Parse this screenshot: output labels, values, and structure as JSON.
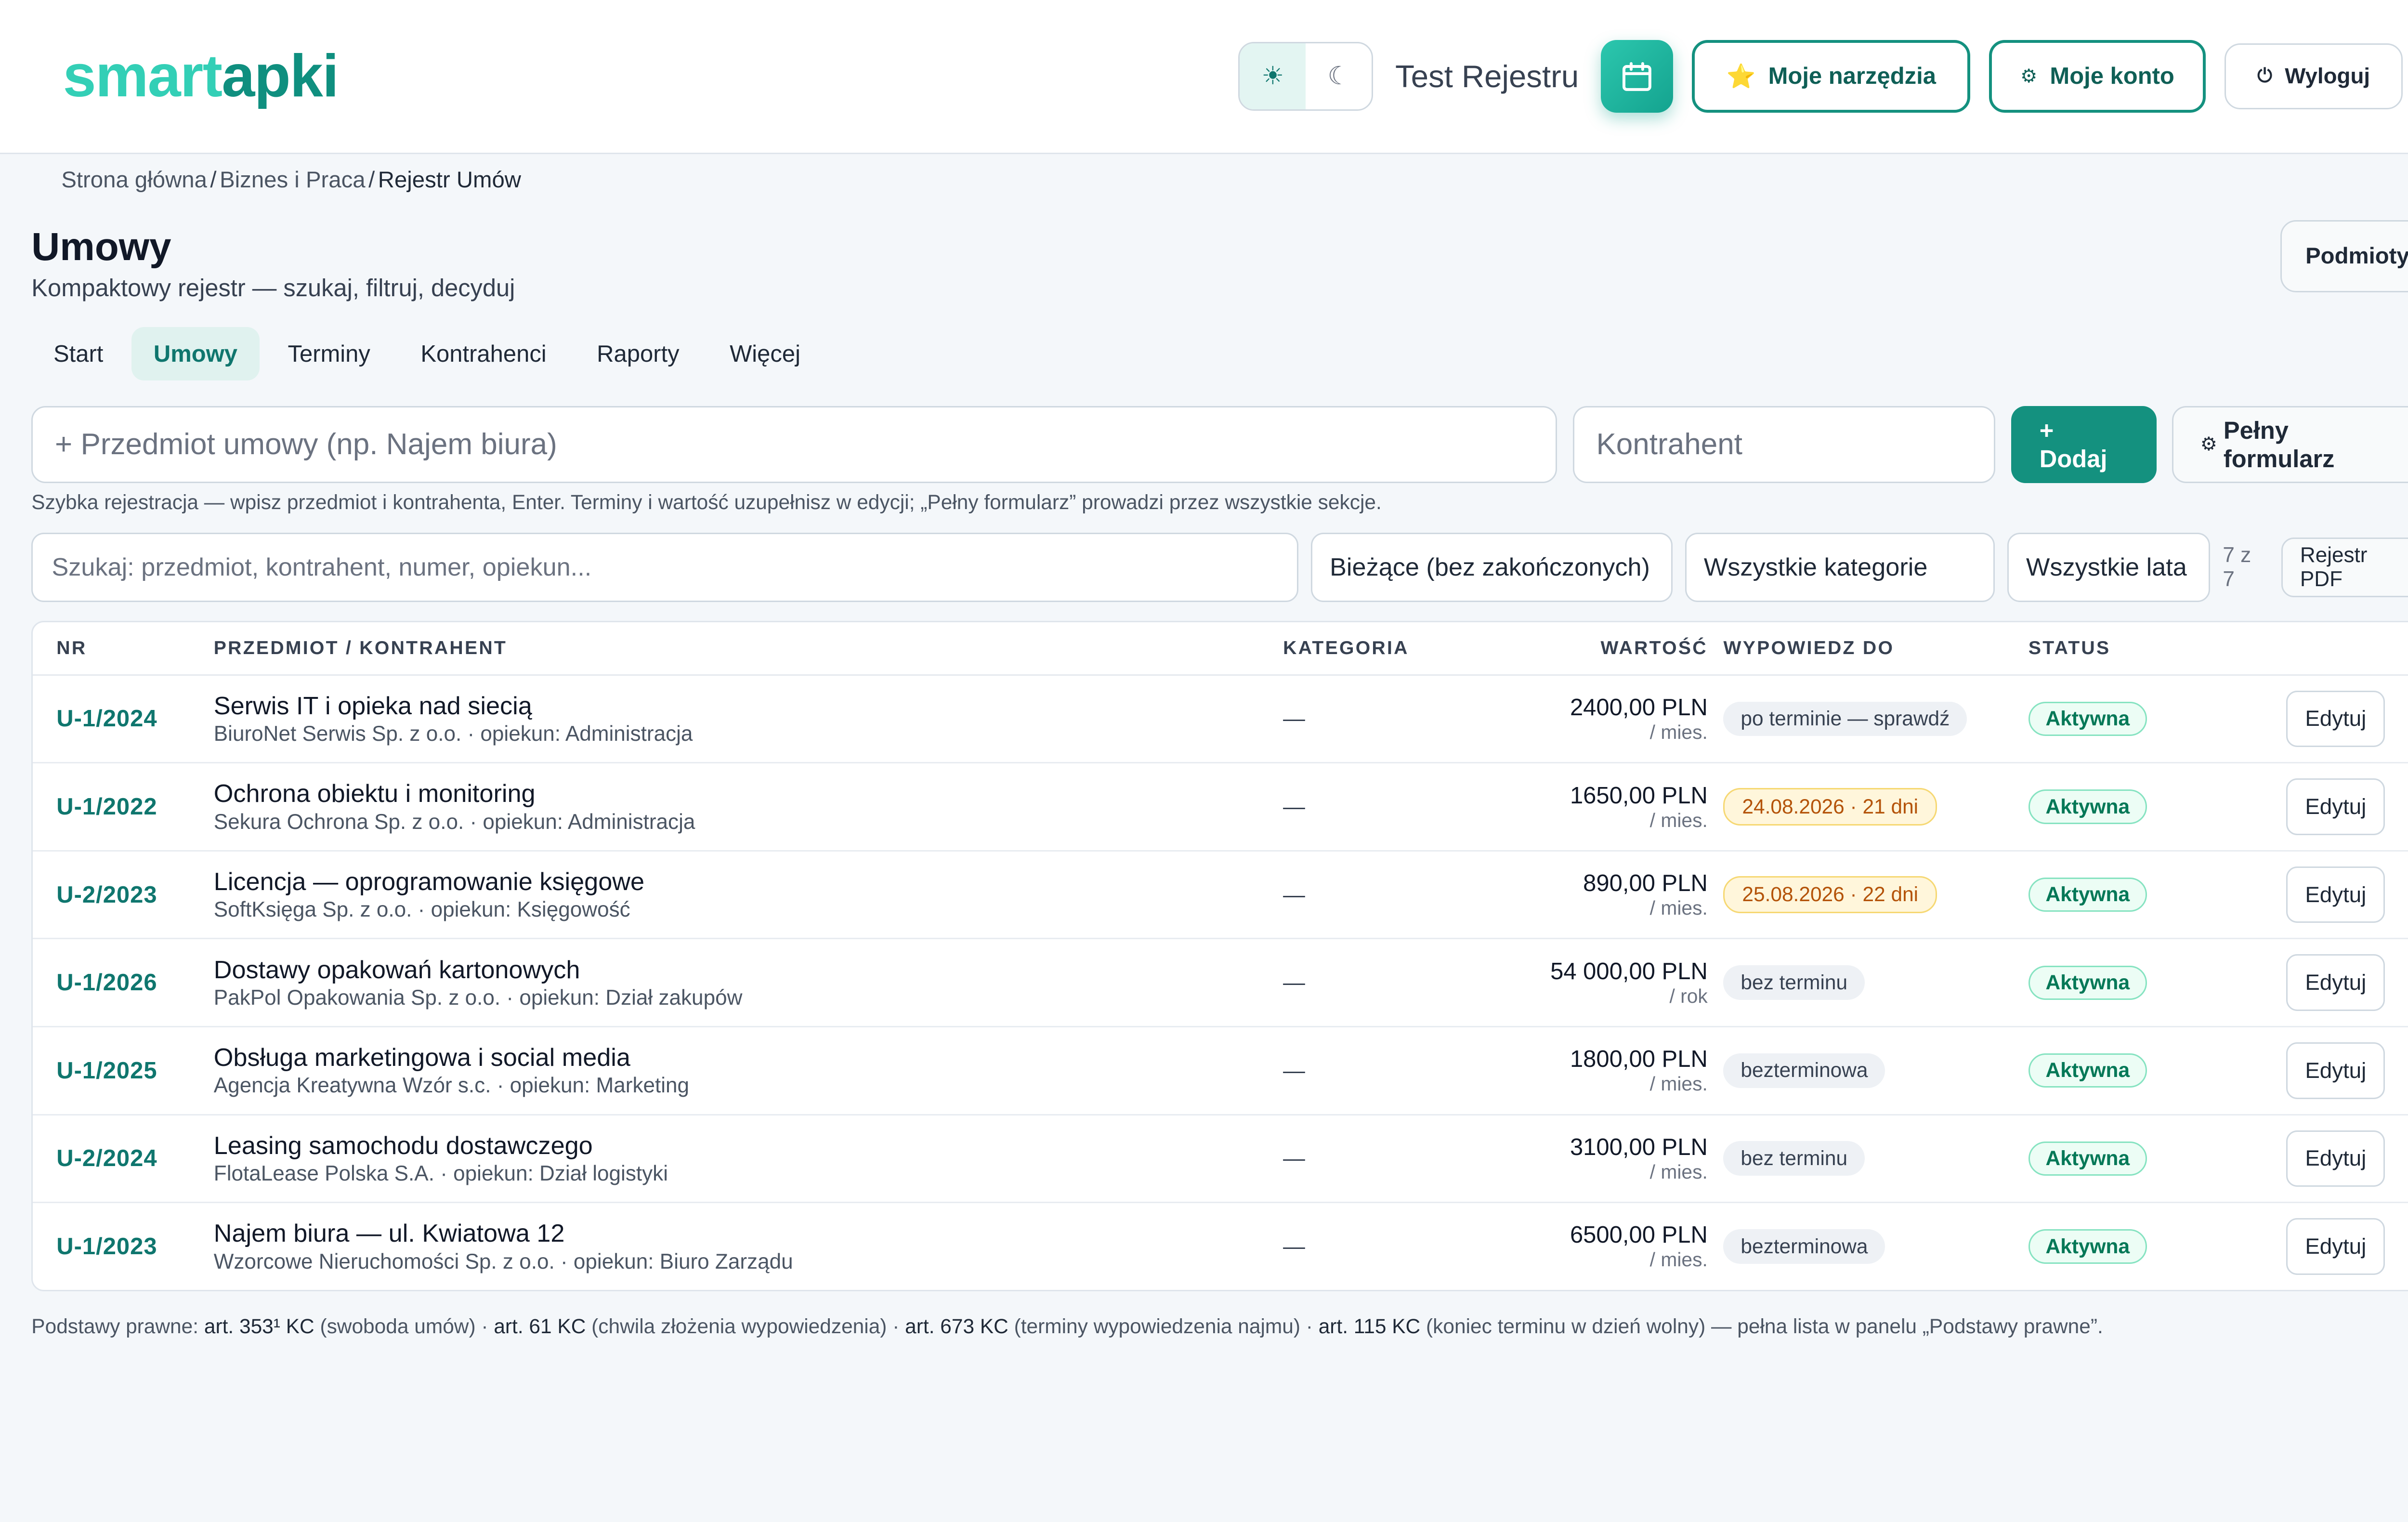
{
  "header": {
    "logo_part1": "smart",
    "logo_part2": "apki",
    "theme_light_icon": "☀",
    "theme_dark_icon": "☾",
    "user_name": "Test Rejestru",
    "tools_label": "Moje narzędzia",
    "tools_icon": "⭐",
    "account_label": "Moje konto",
    "account_icon": "⚙",
    "logout_label": "Wyloguj",
    "logout_icon": "⏻"
  },
  "breadcrumb": {
    "items": [
      "Strona główna",
      "Biznes i Praca",
      "Rejestr Umów"
    ],
    "separator": "/"
  },
  "page": {
    "title": "Umowy",
    "subtitle": "Kompaktowy rejestr — szukaj, filtruj, decyduj",
    "podmioty_label": "Podmioty"
  },
  "tabs": [
    {
      "label": "Start",
      "active": false
    },
    {
      "label": "Umowy",
      "active": true
    },
    {
      "label": "Terminy",
      "active": false
    },
    {
      "label": "Kontrahenci",
      "active": false
    },
    {
      "label": "Raporty",
      "active": false
    },
    {
      "label": "Więcej",
      "active": false
    }
  ],
  "quick_add": {
    "subject_placeholder": "+ Przedmiot umowy (np. Najem biura)",
    "party_placeholder": "Kontrahent",
    "add_label": "+ Dodaj",
    "full_form_label": "Pełny formularz",
    "full_form_icon": "⚙",
    "hint": "Szybka rejestracja — wpisz przedmiot i kontrahenta, Enter. Terminy i wartość uzupełnisz w edycji; „Pełny formularz” prowadzi przez wszystkie sekcje."
  },
  "filters": {
    "search_placeholder": "Szukaj: przedmiot, kontrahent, numer, opiekun...",
    "status_filter": "Bieżące (bez zakończonych)",
    "category_filter": "Wszystkie kategorie",
    "year_filter": "Wszystkie lata",
    "count": "7 z 7",
    "pdf_label": "Rejestr PDF"
  },
  "table": {
    "columns": [
      "NR",
      "PRZEDMIOT / KONTRAHENT",
      "KATEGORIA",
      "WARTOŚĆ",
      "WYPOWIEDZ DO",
      "STATUS"
    ],
    "edit_label": "Edytuj",
    "rows": [
      {
        "nr": "U-1/2024",
        "subject": "Serwis IT i opieka nad siecią",
        "party": "BiuroNet Serwis Sp. z o.o. · opiekun: Administracja",
        "category": "—",
        "amount": "2400,00 PLN",
        "period": "/ mies.",
        "notice": "po terminie — sprawdź",
        "notice_style": "grey",
        "status": "Aktywna"
      },
      {
        "nr": "U-1/2022",
        "subject": "Ochrona obiektu i monitoring",
        "party": "Sekura Ochrona Sp. z o.o. · opiekun: Administracja",
        "category": "—",
        "amount": "1650,00 PLN",
        "period": "/ mies.",
        "notice": "24.08.2026 · 21 dni",
        "notice_style": "amber",
        "status": "Aktywna"
      },
      {
        "nr": "U-2/2023",
        "subject": "Licencja — oprogramowanie księgowe",
        "party": "SoftKsięga Sp. z o.o. · opiekun: Księgowość",
        "category": "—",
        "amount": "890,00 PLN",
        "period": "/ mies.",
        "notice": "25.08.2026 · 22 dni",
        "notice_style": "amber",
        "status": "Aktywna"
      },
      {
        "nr": "U-1/2026",
        "subject": "Dostawy opakowań kartonowych",
        "party": "PakPol Opakowania Sp. z o.o. · opiekun: Dział zakupów",
        "category": "—",
        "amount": "54 000,00 PLN",
        "period": "/ rok",
        "notice": "bez terminu",
        "notice_style": "grey",
        "status": "Aktywna"
      },
      {
        "nr": "U-1/2025",
        "subject": "Obsługa marketingowa i social media",
        "party": "Agencja Kreatywna Wzór s.c. · opiekun: Marketing",
        "category": "—",
        "amount": "1800,00 PLN",
        "period": "/ mies.",
        "notice": "bezterminowa",
        "notice_style": "grey",
        "status": "Aktywna"
      },
      {
        "nr": "U-2/2024",
        "subject": "Leasing samochodu dostawczego",
        "party": "FlotaLease Polska S.A. · opiekun: Dział logistyki",
        "category": "—",
        "amount": "3100,00 PLN",
        "period": "/ mies.",
        "notice": "bez terminu",
        "notice_style": "grey",
        "status": "Aktywna"
      },
      {
        "nr": "U-1/2023",
        "subject": "Najem biura — ul. Kwiatowa 12",
        "party": "Wzorcowe Nieruchomości Sp. z o.o. · opiekun: Biuro Zarządu",
        "category": "—",
        "amount": "6500,00 PLN",
        "period": "/ mies.",
        "notice": "bezterminowa",
        "notice_style": "grey",
        "status": "Aktywna"
      }
    ]
  },
  "legal": {
    "prefix": "Podstawy prawne:",
    "items": [
      {
        "ref": "art. 353¹ KC",
        "desc": "(swoboda umów)"
      },
      {
        "ref": "art. 61 KC",
        "desc": "(chwila złożenia wypowiedzenia)"
      },
      {
        "ref": "art. 673 KC",
        "desc": "(terminy wypowiedzenia najmu)"
      },
      {
        "ref": "art. 115 KC",
        "desc": "(koniec terminu w dzień wolny)"
      }
    ],
    "suffix": "— pełna lista w panelu „Podstawy prawne”."
  },
  "colors": {
    "accent": "#14917f",
    "accent_light": "#33cfb6",
    "status_green": "#047857",
    "warning_amber": "#b45309"
  }
}
